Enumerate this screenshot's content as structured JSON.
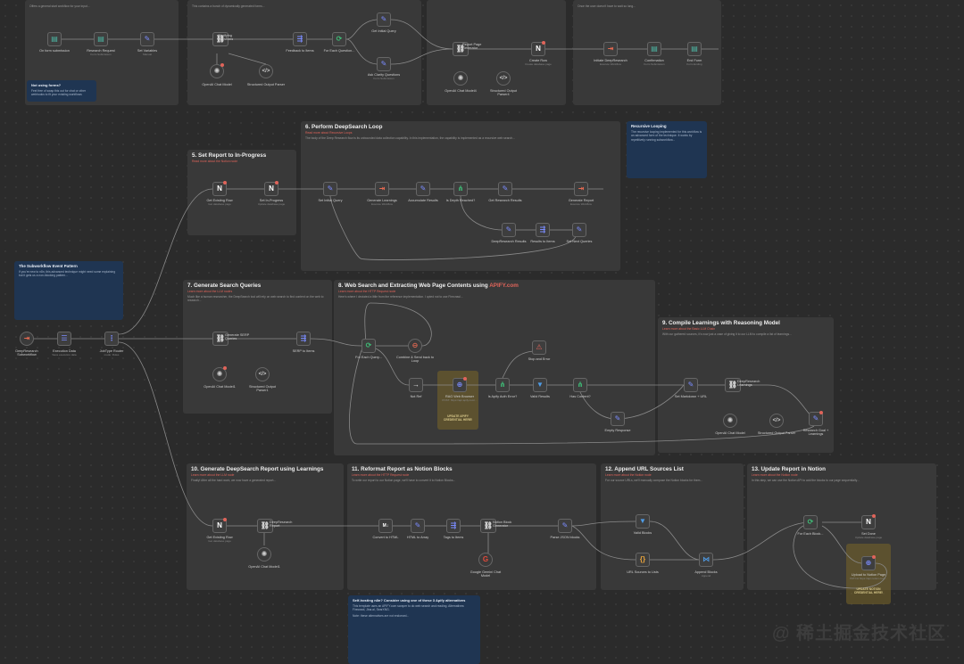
{
  "sections": {
    "top_left": {
      "body": "Offers a general start workflow for your input..."
    },
    "top_mid": {
      "body": "This contains a bunch of dynamically generated forms..."
    },
    "top_right": {
      "body": "Once the user doesn't have to wait so long..."
    },
    "tip_box": {
      "title": "Not using forms?",
      "body": "Feel free of swap this out for chat or other webhooks to fit your existing workflows"
    },
    "s5": {
      "title": "5. Set Report to In-Progress",
      "subtitle": "Read more about the Notion node"
    },
    "s6": {
      "title": "6. Perform DeepSearch Loop",
      "subtitle": "Read more about Recursive Loops",
      "body": "The body of the Deep Research flow is its unbounded data collection capability. In this implementation, the capability is implemented as a recursive web search..."
    },
    "why_recursive": {
      "title": "Recursive Looping",
      "body": "The recursive looping implemented for this workflow is an advanced form of the technique. It works by repetitively running subworkflow..."
    },
    "subworkflow_note": {
      "title": "The Subworkflow Event Pattern",
      "body": "If you're new to n8n, this advanced technique might need some explaining but it gets us a non-blocking pattern..."
    },
    "s7": {
      "title": "7. Generate Search Queries",
      "subtitle": "Learn more about the LLM nodes",
      "body": "Much like a human researcher, the DeepSearch tool will rely on web search to find content on the web to research..."
    },
    "s8": {
      "title": "8. Web Search and Extracting Web Page Contents using ",
      "title_brand": "APIFY.com",
      "subtitle": "Learn more about the HTTP Request node",
      "body": "Here's where I deviated a little from the reference implementation. I opted not to use Firecrawl..."
    },
    "s9": {
      "title": "9. Compile Learnings with Reasoning Model",
      "subtitle": "Learn more about the Basic LLM Chain",
      "body": "With our gathered sources, it's now just a case of giving it to our LLM to compile a list of learnings..."
    },
    "s10": {
      "title": "10. Generate DeepSearch Report using Learnings",
      "subtitle": "Learn more about the LLM node",
      "body": "Finally! After all the hard work, we now have a generated report..."
    },
    "s11": {
      "title": "11. Reformat Report as Notion Blocks",
      "subtitle": "Learn more about the HTTP Request node",
      "body": "To write our report to our Notion page, we'll have to convert it to Notion Blocks..."
    },
    "s12": {
      "title": "12. Append URL Sources List",
      "subtitle": "Learn more about the Notion node",
      "body": "For our source URLs, we'll manually compose the Notion blocks for them..."
    },
    "s13": {
      "title": "13. Update Report in Notion",
      "subtitle": "Learn more about the Notion node",
      "body": "In this step, we can use the Notion API to add the blocks to our page sequentially..."
    },
    "selfhost": {
      "title": "Self-hosting n8n? Consider using one of these 3 Apify alternatives",
      "body": "This template uses an APIFY.com scraper to do web search and reading. Alternatives: Firecrawl, Jina.ai, SearXNG.",
      "note": "Note: these alternatives are not endorsed..."
    }
  },
  "nodes": {
    "on_form": {
      "label": "On form submission"
    },
    "research_request": {
      "label": "Research Request",
      "sub": "Form Submission"
    },
    "set_variables": {
      "label": "Set Variables",
      "sub": "Manual"
    },
    "clarifying": {
      "label": "Clarifying Questions",
      "sub": "Basic LLM Chain"
    },
    "feedback": {
      "label": "Feedback to Items"
    },
    "for_each_q": {
      "label": "For Each Question..."
    },
    "get_initial": {
      "label": "Get Initial Query"
    },
    "ask_clarity": {
      "label": "Ask Clarity Questions",
      "sub": "Form Submission"
    },
    "openai_1": {
      "label": "OpenAI Chat Model"
    },
    "structured_1": {
      "label": "Structured Output Parser"
    },
    "report_page_gen": {
      "label": "Report Page Generator",
      "sub": "Basic LLM Chain"
    },
    "create_row": {
      "label": "Create Row",
      "sub": "Create database page"
    },
    "openai_4": {
      "label": "OpenAI Chat Model4"
    },
    "structured_4": {
      "label": "Structured Output Parser4"
    },
    "initiate": {
      "label": "Initiate DeepResearch",
      "sub": "Execute Workflow"
    },
    "confirmation": {
      "label": "Confirmation",
      "sub": "Form Submission"
    },
    "end_form": {
      "label": "End Form",
      "sub": "Form Ending"
    },
    "get_existing_row": {
      "label": "Get Existing Row",
      "sub": "Get database page"
    },
    "set_inprogress": {
      "label": "Set In-Progress",
      "sub": "Update database page"
    },
    "set_initial_query": {
      "label": "Set Initial Query"
    },
    "generate_learnings": {
      "label": "Generate Learnings",
      "sub": "Execute Workflow"
    },
    "accumulate": {
      "label": "Accumulate Results"
    },
    "is_depth": {
      "label": "Is Depth Reached?"
    },
    "get_research": {
      "label": "Get Research Results"
    },
    "generate_report": {
      "label": "Generate Report",
      "sub": "Execute Workflow"
    },
    "deepresearch_results": {
      "label": "DeepResearch Results"
    },
    "results_items": {
      "label": "Results to Items"
    },
    "set_next": {
      "label": "Set Next Queries"
    },
    "subworkflow": {
      "label": "DeepResearch Subworkflow"
    },
    "exec_data": {
      "label": "Execution Data",
      "sub": "Save execution data"
    },
    "jobtype": {
      "label": "JobType Router",
      "sub": "mode: Rules"
    },
    "gen_serp": {
      "label": "Generate SERP Queries",
      "sub": "Basic LLM Chain"
    },
    "serp_items": {
      "label": "SERP to Items"
    },
    "openai_7": {
      "label": "OpenAI Chat Model1"
    },
    "structured_7": {
      "label": "Structured Output Parser1"
    },
    "for_each_query": {
      "label": "For Each Query..."
    },
    "combine": {
      "label": "Combine & Send back to Loop"
    },
    "stop_error": {
      "label": "Stop and Error"
    },
    "noop": {
      "label": "Not Ref"
    },
    "web_search": {
      "label": "RAG Web Browser",
      "sub": "POST: https://api.apify.com/..."
    },
    "valid": {
      "label": "Is Apify Auth Error?"
    },
    "valid_results": {
      "label": "Valid Results"
    },
    "has_content": {
      "label": "Has Content?"
    },
    "empty_response": {
      "label": "Empty Response"
    },
    "apify_note": "UPDATE APIFY CREDENTIAL HERE!",
    "set_markdown": {
      "label": "Set Markdown + URL"
    },
    "deepresearch_learnings": {
      "label": "DeepResearch Learnings"
    },
    "openai_9": {
      "label": "OpenAI Chat Model"
    },
    "structured_9": {
      "label": "Structured Output Parser"
    },
    "research_goal": {
      "label": "Research Goal + Learnings"
    },
    "get_existing_row2": {
      "label": "Get Existing Row",
      "sub": "Get database page"
    },
    "deepresearch_report": {
      "label": "DeepResearch Report",
      "sub": "Basic LLM Chain"
    },
    "openai_10": {
      "label": "OpenAI Chat Model1"
    },
    "convert_html": {
      "label": "Convert to HTML"
    },
    "html_array": {
      "label": "HTML to Array"
    },
    "tags_items": {
      "label": "Tags to Items"
    },
    "notion_gen": {
      "label": "Notion Block Generator",
      "sub": "Basic LLM Chain"
    },
    "parse_json": {
      "label": "Parse JSON blocks"
    },
    "gemini": {
      "label": "Google Gemini Chat Model"
    },
    "valid_blocks": {
      "label": "Valid Blocks"
    },
    "url_sources": {
      "label": "URL Sources to Lists"
    },
    "append_blocks": {
      "label": "Append Blocks",
      "sub": "Append"
    },
    "for_each_block": {
      "label": "For Each Block..."
    },
    "set_done": {
      "label": "Set Done",
      "sub": "Update database page"
    },
    "upload_notion": {
      "label": "Upload to Notion Page",
      "sub": "PATCH https://api.notion.com..."
    },
    "notion_note": "UPDATE NOTION CREDENTIAL HERE!"
  },
  "watermark": "@ 稀土掘金技术社区",
  "colors": {
    "accent_red": "#e0645a",
    "sticky": "#393939",
    "sticky_blue": "#1f3552",
    "highlight": "#7a6628"
  }
}
